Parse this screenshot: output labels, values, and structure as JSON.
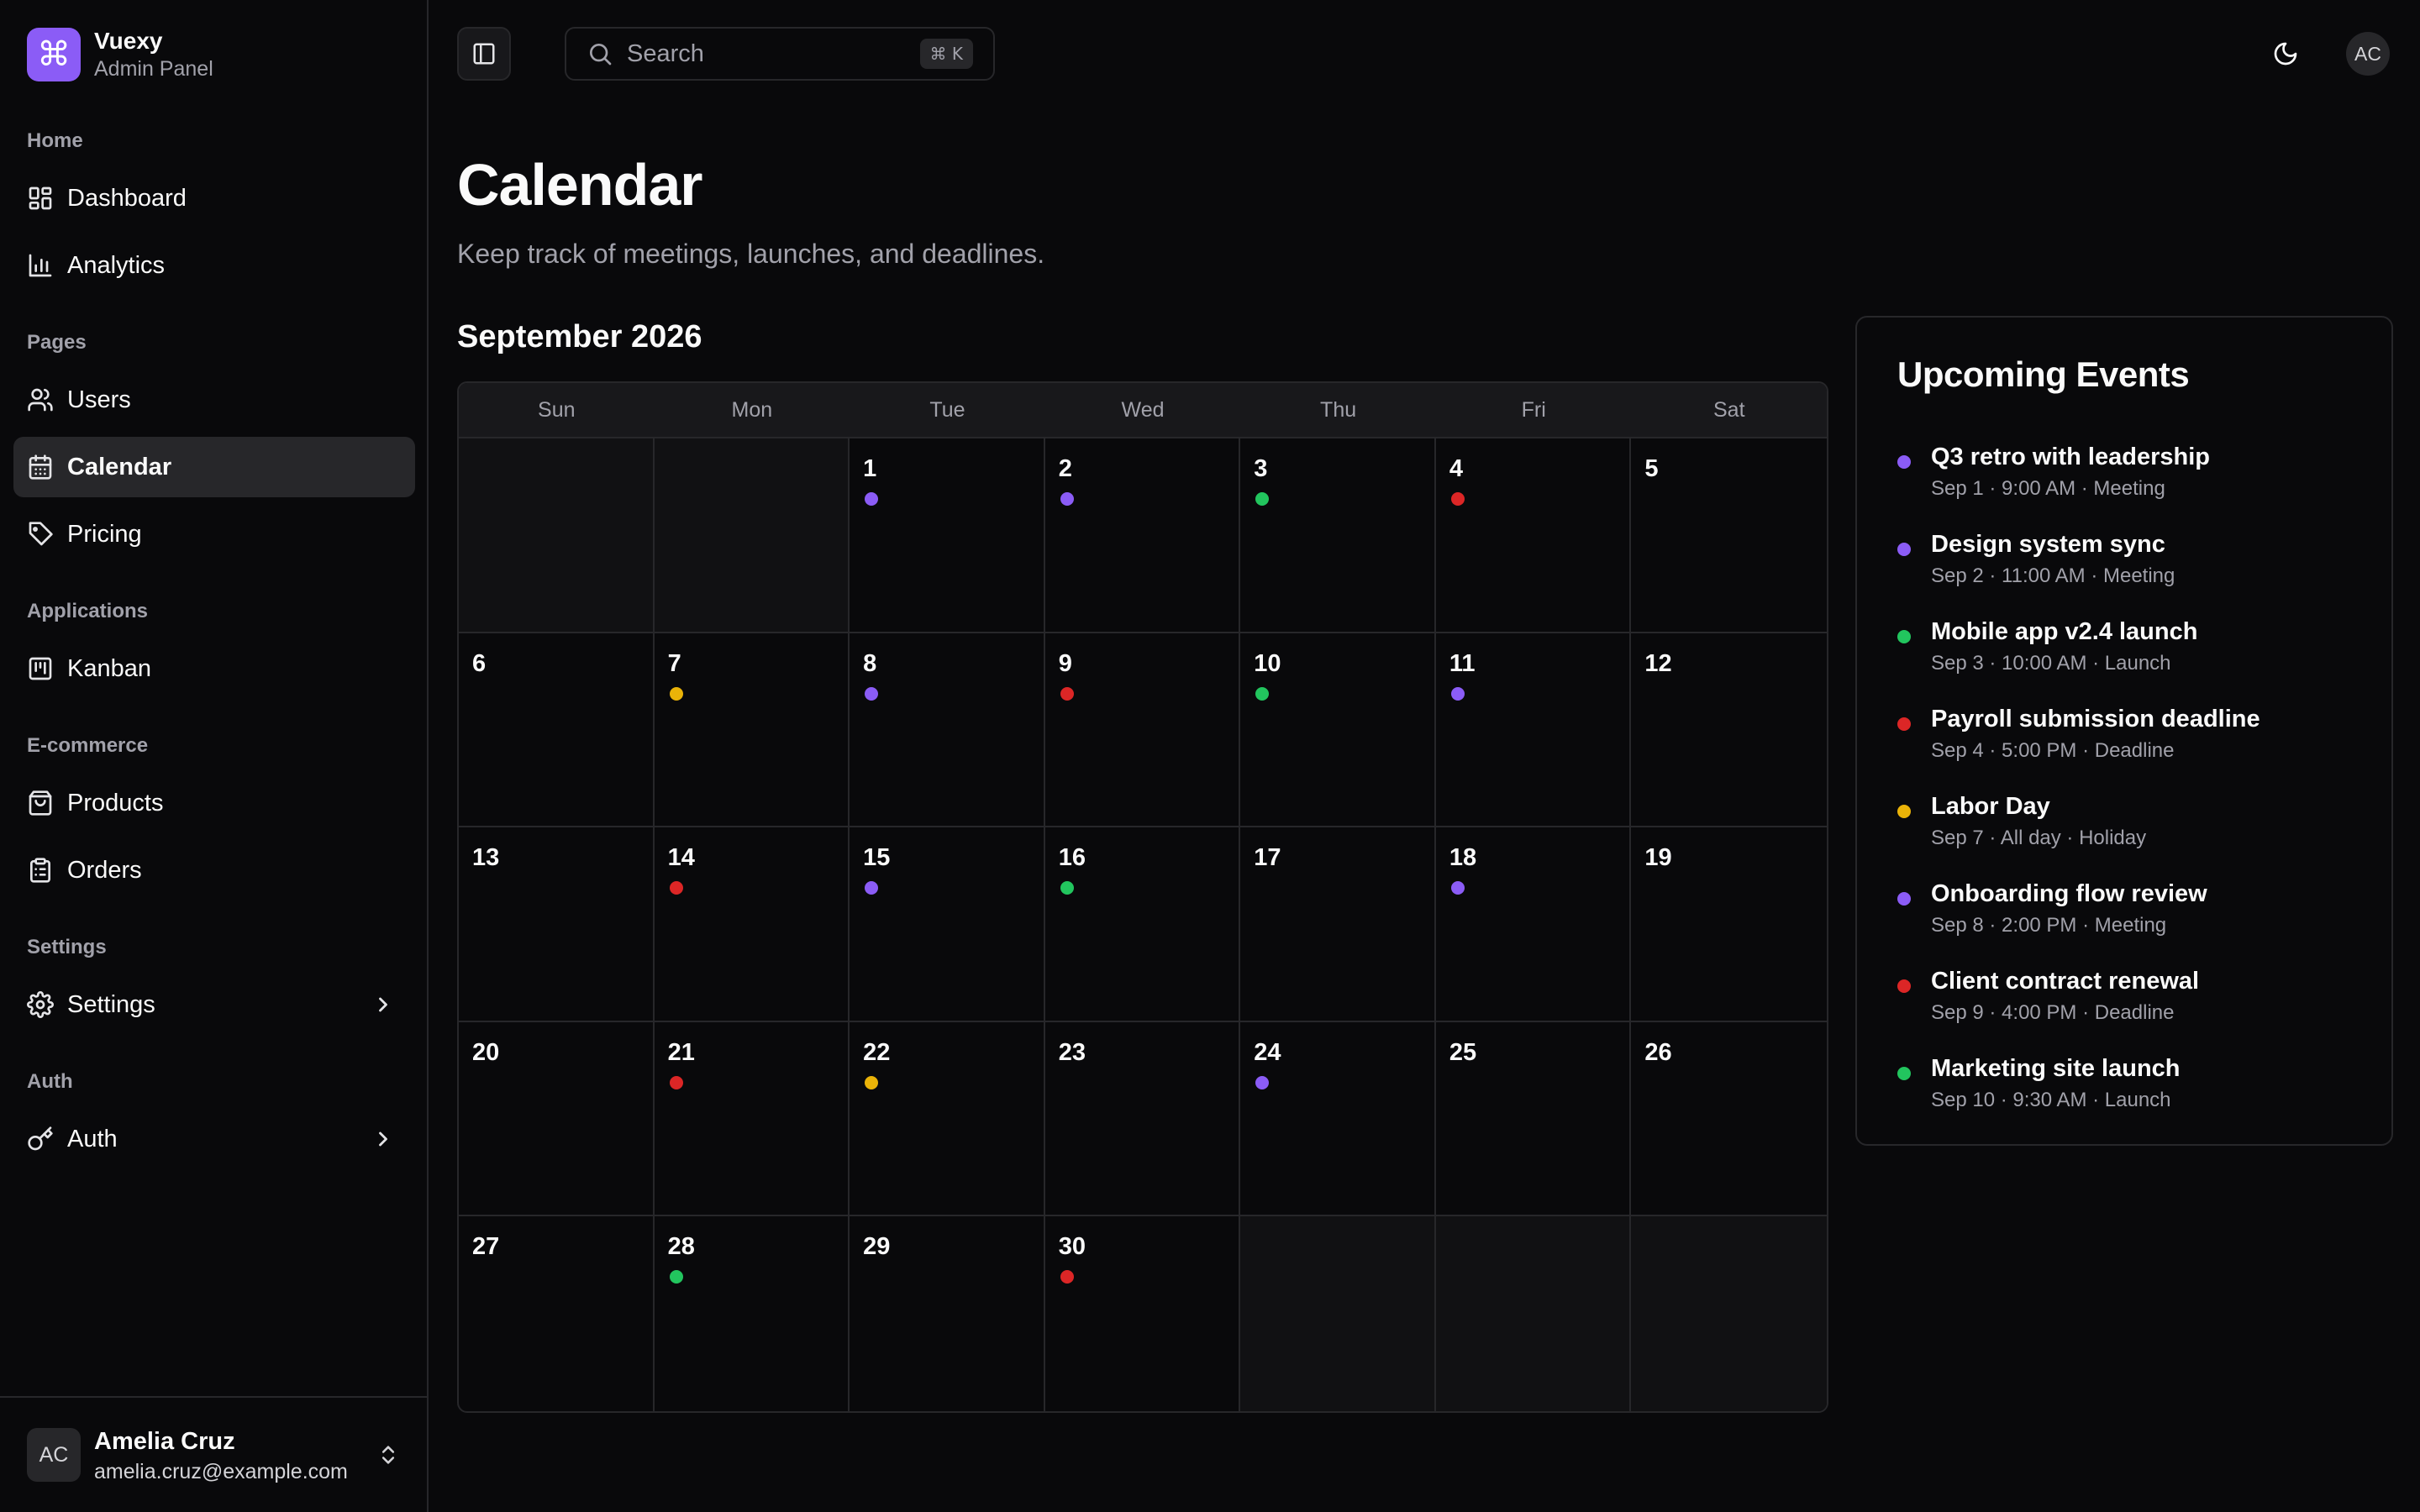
{
  "brand": {
    "name": "Vuexy",
    "subtitle": "Admin Panel",
    "logo_icon": "command-icon",
    "logo_color": "#8b5cf6"
  },
  "sidebar": {
    "groups": [
      {
        "label": "Home",
        "items": [
          {
            "label": "Dashboard",
            "icon": "dashboard-icon"
          },
          {
            "label": "Analytics",
            "icon": "bar-chart-icon"
          }
        ]
      },
      {
        "label": "Pages",
        "items": [
          {
            "label": "Users",
            "icon": "users-icon"
          },
          {
            "label": "Calendar",
            "icon": "calendar-icon",
            "active": true
          },
          {
            "label": "Pricing",
            "icon": "tag-icon"
          }
        ]
      },
      {
        "label": "Applications",
        "items": [
          {
            "label": "Kanban",
            "icon": "kanban-icon"
          }
        ]
      },
      {
        "label": "E-commerce",
        "items": [
          {
            "label": "Products",
            "icon": "shopping-bag-icon"
          },
          {
            "label": "Orders",
            "icon": "clipboard-list-icon"
          }
        ]
      },
      {
        "label": "Settings",
        "items": [
          {
            "label": "Settings",
            "icon": "gear-icon",
            "has_children": true
          }
        ]
      },
      {
        "label": "Auth",
        "items": [
          {
            "label": "Auth",
            "icon": "key-icon",
            "has_children": true
          }
        ]
      }
    ]
  },
  "user": {
    "initials": "AC",
    "name": "Amelia Cruz",
    "email": "amelia.cruz@example.com"
  },
  "topbar": {
    "search_placeholder": "Search",
    "shortcut": "⌘ K",
    "avatar_initials": "AC"
  },
  "page": {
    "title": "Calendar",
    "subtitle": "Keep track of meetings, launches, and deadlines."
  },
  "calendar": {
    "month_label": "September 2026",
    "weekdays": [
      "Sun",
      "Mon",
      "Tue",
      "Wed",
      "Thu",
      "Fri",
      "Sat"
    ],
    "weeks": [
      [
        null,
        null,
        1,
        2,
        3,
        4,
        5
      ],
      [
        6,
        7,
        8,
        9,
        10,
        11,
        12
      ],
      [
        13,
        14,
        15,
        16,
        17,
        18,
        19
      ],
      [
        20,
        21,
        22,
        23,
        24,
        25,
        26
      ],
      [
        27,
        28,
        29,
        30,
        null,
        null,
        null
      ]
    ],
    "day_events": {
      "1": "Meeting",
      "2": "Meeting",
      "3": "Launch",
      "4": "Deadline",
      "7": "Holiday",
      "8": "Meeting",
      "9": "Deadline",
      "10": "Launch",
      "11": "Meeting",
      "14": "Deadline",
      "15": "Meeting",
      "16": "Launch",
      "18": "Meeting",
      "21": "Deadline",
      "22": "Holiday",
      "24": "Meeting",
      "28": "Launch",
      "30": "Deadline"
    }
  },
  "event_colors": {
    "Meeting": "#8b5cf6",
    "Launch": "#22c55e",
    "Deadline": "#dc2626",
    "Holiday": "#eab308"
  },
  "upcoming": {
    "title": "Upcoming Events",
    "events": [
      {
        "name": "Q3 retro with leadership",
        "meta": "Sep 1 · 9:00 AM · Meeting",
        "type": "Meeting"
      },
      {
        "name": "Design system sync",
        "meta": "Sep 2 · 11:00 AM · Meeting",
        "type": "Meeting"
      },
      {
        "name": "Mobile app v2.4 launch",
        "meta": "Sep 3 · 10:00 AM · Launch",
        "type": "Launch"
      },
      {
        "name": "Payroll submission deadline",
        "meta": "Sep 4 · 5:00 PM · Deadline",
        "type": "Deadline"
      },
      {
        "name": "Labor Day",
        "meta": "Sep 7 · All day · Holiday",
        "type": "Holiday"
      },
      {
        "name": "Onboarding flow review",
        "meta": "Sep 8 · 2:00 PM · Meeting",
        "type": "Meeting"
      },
      {
        "name": "Client contract renewal",
        "meta": "Sep 9 · 4:00 PM · Deadline",
        "type": "Deadline"
      },
      {
        "name": "Marketing site launch",
        "meta": "Sep 10 · 9:30 AM · Launch",
        "type": "Launch"
      }
    ]
  }
}
